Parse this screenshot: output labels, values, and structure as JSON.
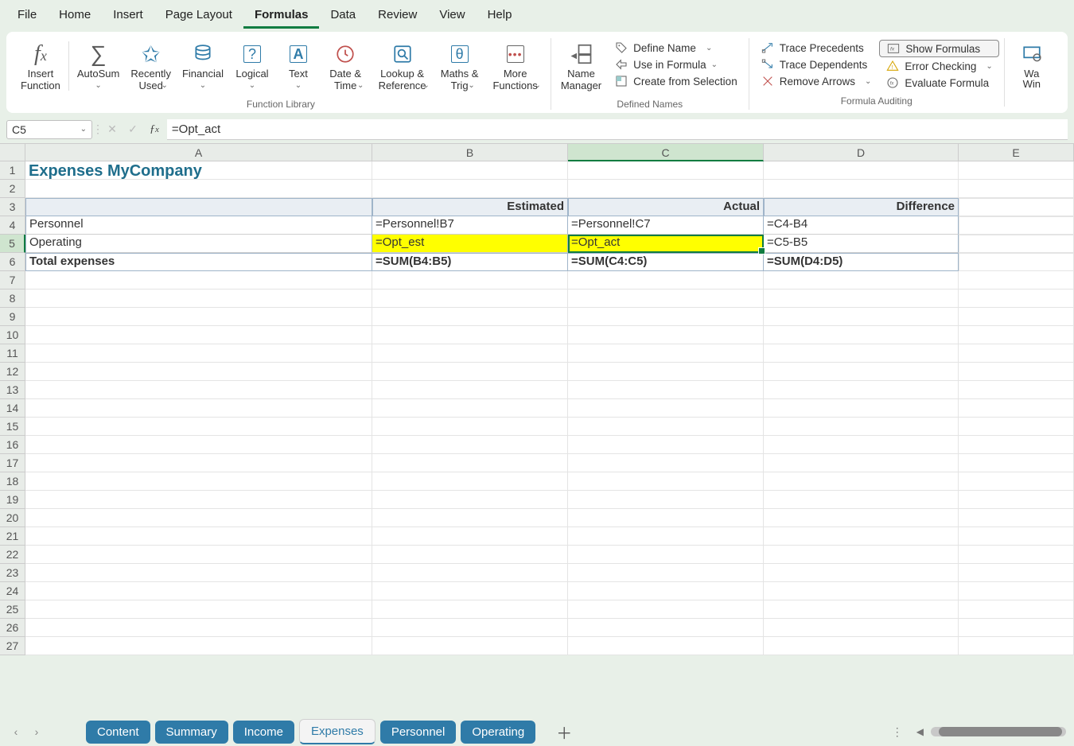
{
  "menu": {
    "items": [
      "File",
      "Home",
      "Insert",
      "Page Layout",
      "Formulas",
      "Data",
      "Review",
      "View",
      "Help"
    ],
    "active": "Formulas"
  },
  "ribbon": {
    "groups": {
      "function_library": {
        "label": "Function Library",
        "insert_function": "Insert\nFunction",
        "autosum": "AutoSum",
        "recently_used": "Recently\nUsed",
        "financial": "Financial",
        "logical": "Logical",
        "text": "Text",
        "date_time": "Date &\nTime",
        "lookup_ref": "Lookup &\nReference",
        "maths_trig": "Maths &\nTrig",
        "more_functions": "More\nFunctions"
      },
      "defined_names": {
        "label": "Defined Names",
        "name_manager": "Name\nManager",
        "define_name": "Define Name",
        "use_in_formula": "Use in Formula",
        "create_from_selection": "Create from Selection"
      },
      "formula_auditing": {
        "label": "Formula Auditing",
        "trace_precedents": "Trace Precedents",
        "trace_dependents": "Trace Dependents",
        "remove_arrows": "Remove Arrows",
        "show_formulas": "Show Formulas",
        "error_checking": "Error Checking",
        "evaluate_formula": "Evaluate Formula"
      },
      "watch": {
        "watch_window": "Wa",
        "watch_window2": "Win"
      }
    }
  },
  "formula_bar": {
    "name_box": "C5",
    "formula": "=Opt_act"
  },
  "columns": [
    "A",
    "B",
    "C",
    "D",
    "E"
  ],
  "sheet": {
    "title": "Expenses MyCompany",
    "headers": {
      "a": "",
      "b": "Estimated",
      "c": "Actual",
      "d": "Difference"
    },
    "rows": [
      {
        "a": "Personnel",
        "b": "=Personnel!B7",
        "c": "=Personnel!C7",
        "d": "=C4-B4"
      },
      {
        "a": "Operating",
        "b": "=Opt_est",
        "c": "=Opt_act",
        "d": "=C5-B5",
        "highlight": true
      },
      {
        "a": "Total expenses",
        "b": "=SUM(B4:B5)",
        "c": "=SUM(C4:C5)",
        "d": "=SUM(D4:D5)",
        "total": true
      }
    ]
  },
  "sheet_tabs": {
    "tabs": [
      "Content",
      "Summary",
      "Income",
      "Expenses",
      "Personnel",
      "Operating"
    ],
    "active": "Expenses"
  }
}
